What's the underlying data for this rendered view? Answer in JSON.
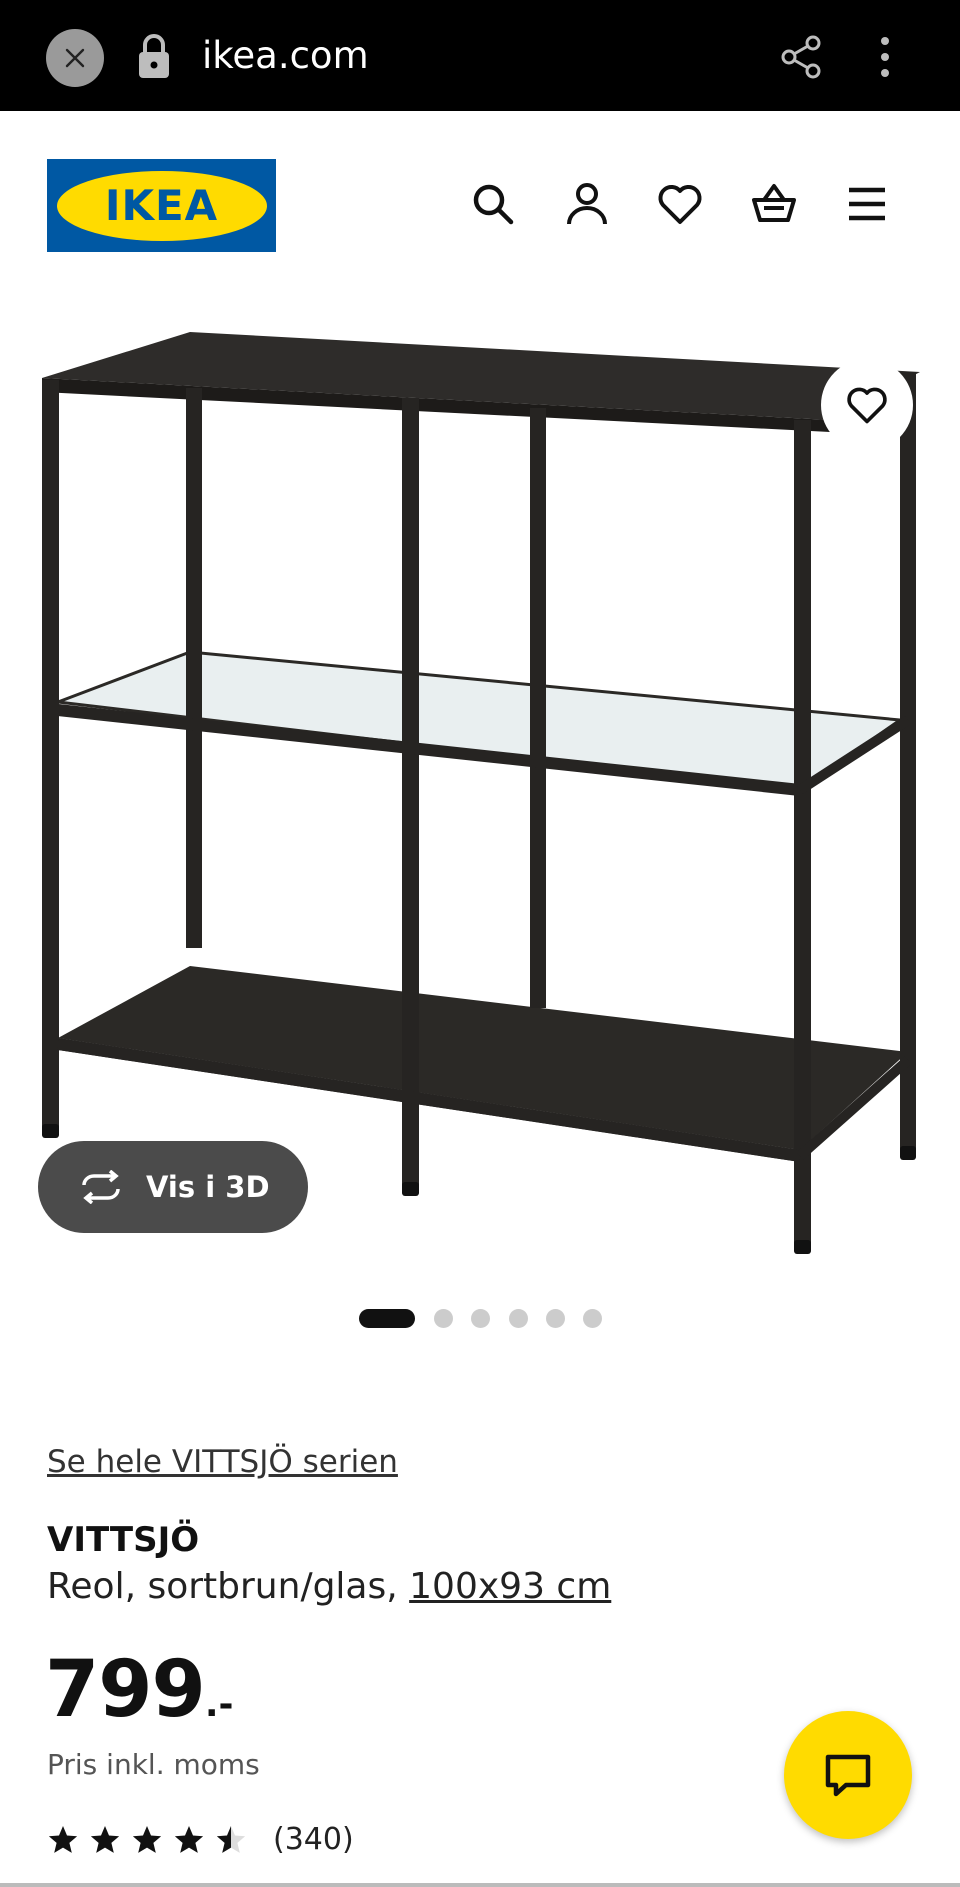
{
  "browser": {
    "url": "ikea.com",
    "icons": [
      "close-icon",
      "lock-icon",
      "share-icon",
      "more-vert-icon"
    ]
  },
  "header": {
    "logo_text": "IKEA",
    "brand_colors": {
      "blue": "#0058a3",
      "yellow": "#ffdb00"
    },
    "nav_icons": [
      "search-icon",
      "account-icon",
      "heart-icon",
      "cart-icon",
      "menu-icon"
    ]
  },
  "gallery": {
    "view3d_label": "Vis i 3D",
    "image_count": 6,
    "active_index": 0
  },
  "product": {
    "series_link": "Se hele VITTSJÖ serien",
    "name": "VITTSJÖ",
    "description": "Reol, sortbrun/glas,",
    "size": "100x93 cm",
    "price_integer": "799",
    "price_suffix": ".-",
    "price_note": "Pris inkl. moms",
    "rating": 4.5,
    "rating_max": 5,
    "review_count": "(340)"
  },
  "chat": {
    "icon": "chat-icon",
    "color": "#ffdb00"
  }
}
